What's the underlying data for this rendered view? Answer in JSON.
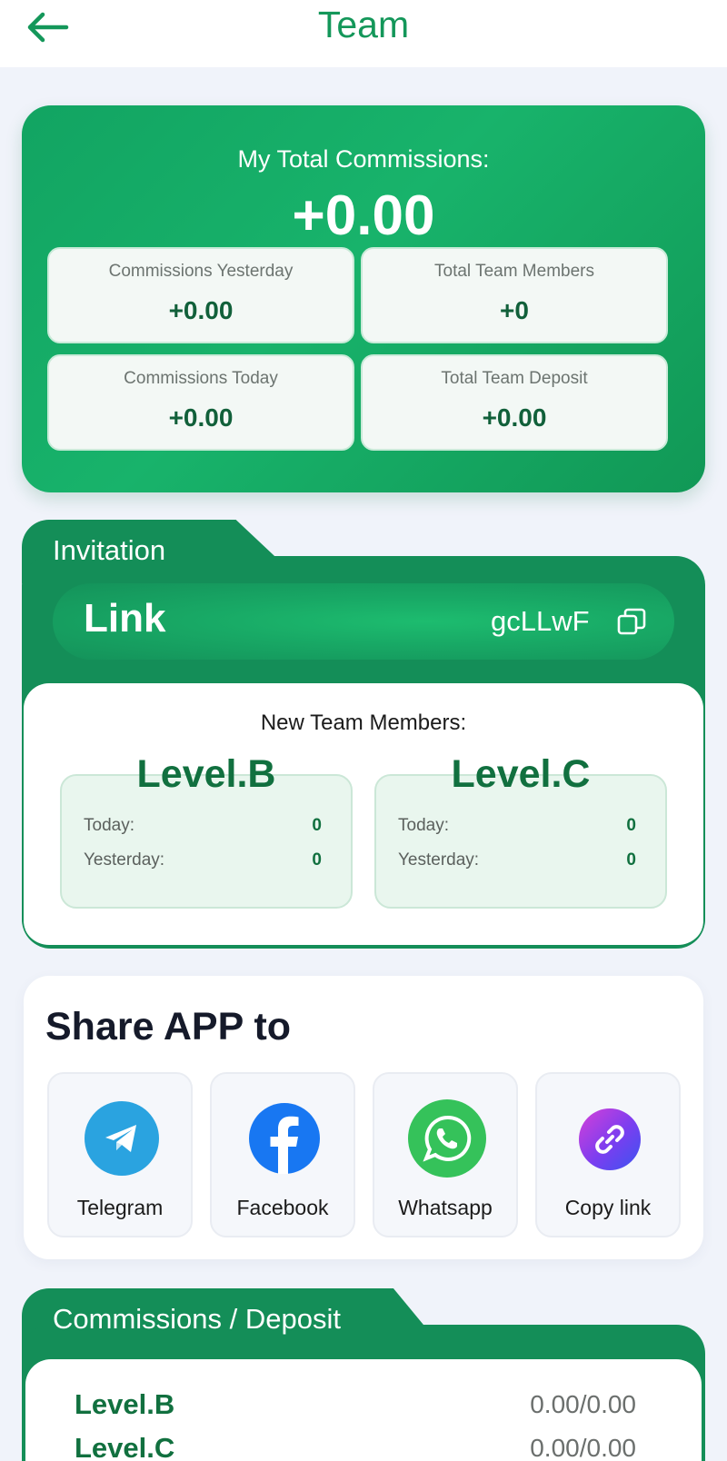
{
  "header": {
    "title": "Team",
    "back_icon": "arrow-left-icon"
  },
  "summary": {
    "label": "My Total Commissions:",
    "value": "+0.00",
    "stats": [
      {
        "label": "Commissions Yesterday",
        "value": "+0.00"
      },
      {
        "label": "Total Team Members",
        "value": "+0"
      },
      {
        "label": "Commissions Today",
        "value": "+0.00"
      },
      {
        "label": "Total Team Deposit",
        "value": "+0.00"
      }
    ]
  },
  "invitation": {
    "tab_label": "Invitation",
    "link_label": "Link",
    "code": "gcLLwF",
    "new_members_title": "New Team Members:",
    "levels": [
      {
        "name": "Level.B",
        "today_label": "Today:",
        "today": "0",
        "yesterday_label": "Yesterday:",
        "yesterday": "0"
      },
      {
        "name": "Level.C",
        "today_label": "Today:",
        "today": "0",
        "yesterday_label": "Yesterday:",
        "yesterday": "0"
      }
    ]
  },
  "share": {
    "title": "Share APP to",
    "options": [
      {
        "label": "Telegram",
        "icon": "telegram-icon",
        "color": "#2aa3e0"
      },
      {
        "label": "Facebook",
        "icon": "facebook-icon",
        "color": "#1877f2"
      },
      {
        "label": "Whatsapp",
        "icon": "whatsapp-icon",
        "color": "#35c25a"
      },
      {
        "label": "Copy link",
        "icon": "link-icon",
        "color": "#8b3df0"
      }
    ]
  },
  "commissions_deposit": {
    "tab_label": "Commissions / Deposit",
    "rows": [
      {
        "level": "Level.B",
        "value": "0.00/0.00"
      },
      {
        "level": "Level.C",
        "value": "0.00/0.00"
      }
    ]
  },
  "colors": {
    "brand_green": "#148e58",
    "accent_green": "#18b36b",
    "dark_green_text": "#11703f"
  }
}
